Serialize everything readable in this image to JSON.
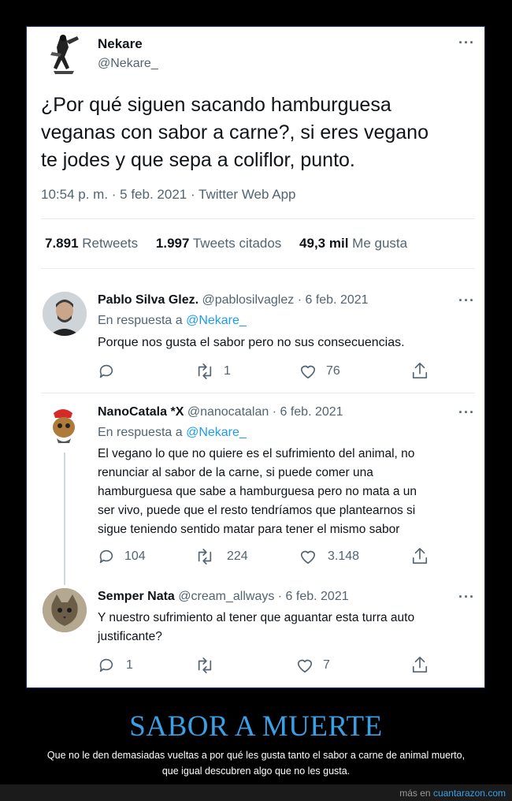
{
  "main_tweet": {
    "author_name": "Nekare",
    "author_handle": "@Nekare_",
    "text_lines": [
      "¿Por qué siguen sacando hamburguesa",
      "veganas con sabor a carne?, si eres vegano",
      "te jodes y que sepa a coliflor, punto."
    ],
    "meta": "10:54 p. m. · 5 feb. 2021 · Twitter Web App",
    "stats": {
      "retweets_count": "7.891",
      "retweets_label": "Retweets",
      "quotes_count": "1.997",
      "quotes_label": "Tweets citados",
      "likes_count": "49,3 mil",
      "likes_label": "Me gusta"
    }
  },
  "replies": [
    {
      "name": "Pablo Silva Glez.",
      "handle_date": "@pablosilvaglez · 6 feb. 2021",
      "reply_prefix": "En respuesta a",
      "reply_to": "@Nekare_",
      "text_lines": [
        "Porque nos gusta el sabor pero no sus consecuencias."
      ],
      "reply_count": "",
      "retweet_count": "1",
      "like_count": "76"
    },
    {
      "name": "NanoCatala *X",
      "handle_date": "@nanocatalan · 6 feb. 2021",
      "reply_prefix": "En respuesta a",
      "reply_to": "@Nekare_",
      "text_lines": [
        "El vegano lo que no quiere es el sufrimiento del animal, no",
        "renunciar al sabor de la carne, si puede comer una",
        "hamburguesa que sabe a hamburguesa pero no mata a un",
        "ser vivo, puede que el resto tendríamos que plantearnos si",
        "sigue teniendo sentido matar para tener el mismo sabor"
      ],
      "reply_count": "104",
      "retweet_count": "224",
      "like_count": "3.148"
    },
    {
      "name": "Semper Nata",
      "handle_date": "@cream_allways · 6 feb. 2021",
      "text_lines": [
        "Y nuestro sufrimiento al tener que aguantar esta turra auto",
        "justificante?"
      ],
      "reply_count": "1",
      "retweet_count": "",
      "like_count": "7"
    }
  ],
  "footer": {
    "headline": "SABOR A MUERTE",
    "caption_line1": "Que no le den demasiadas vueltas a por qué les gusta tanto el sabor a carne de animal muerto,",
    "caption_line2": "que igual descubren algo que no les gusta.",
    "credit_prefix": "más en",
    "credit_link": "cuantarazon.com"
  },
  "colors": {
    "accent": "#1d9bf0",
    "headline": "#3aa0e6",
    "muted": "#536471",
    "frame_border": "#1d2a6e"
  },
  "icons": [
    "more-icon",
    "reply-icon",
    "retweet-icon",
    "like-icon",
    "share-icon"
  ]
}
